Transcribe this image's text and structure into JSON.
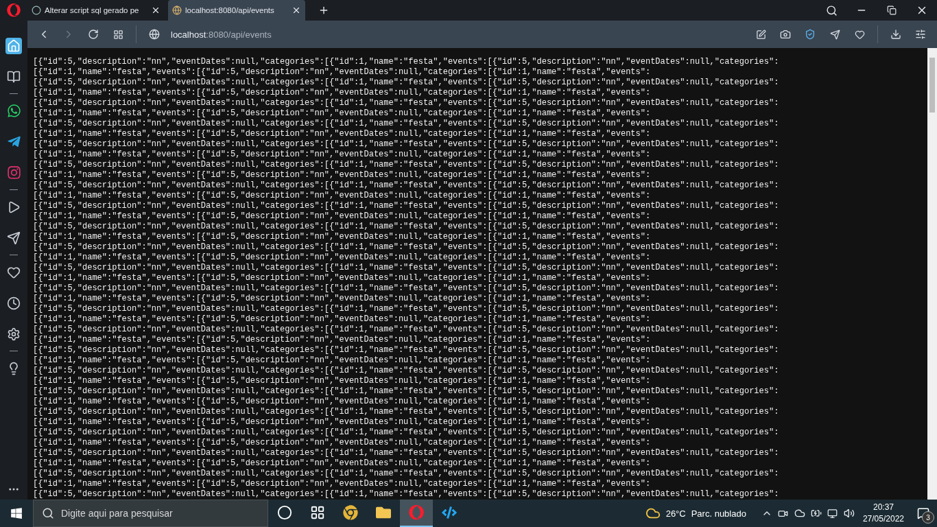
{
  "browser": {
    "tabs": [
      {
        "title": "Alterar script sql gerado pe",
        "selected": false
      },
      {
        "title": "localhost:8080/api/events",
        "selected": true
      }
    ],
    "address": {
      "host": "localhost",
      "path": ":8080/api/events"
    }
  },
  "sidebar": {
    "items": [
      {
        "kind": "home",
        "selected": true
      },
      {
        "kind": "book",
        "selected": false
      },
      {
        "kind": "divider"
      },
      {
        "kind": "chat",
        "selected": false
      },
      {
        "kind": "plane",
        "selected": false
      },
      {
        "kind": "camera",
        "selected": false
      },
      {
        "kind": "divider"
      },
      {
        "kind": "play",
        "selected": false
      },
      {
        "kind": "send",
        "selected": false
      },
      {
        "kind": "divider"
      },
      {
        "kind": "heart",
        "selected": false
      },
      {
        "kind": "clock",
        "selected": false
      },
      {
        "kind": "gear",
        "selected": false
      },
      {
        "kind": "divider"
      },
      {
        "kind": "bulb",
        "selected": false
      }
    ]
  },
  "response": {
    "lines": [
      "[{\"id\":5,\"description\":\"nn\",\"eventDates\":null,\"categories\":[{\"id\":1,\"name\":\"festa\",\"events\":[{\"id\":5,\"description\":\"nn\",\"eventDates\":null,\"categories\":",
      "[{\"id\":1,\"name\":\"festa\",\"events\":[{\"id\":5,\"description\":\"nn\",\"eventDates\":null,\"categories\":[{\"id\":1,\"name\":\"festa\",\"events\":",
      "[{\"id\":5,\"description\":\"nn\",\"eventDates\":null,\"categories\":[{\"id\":1,\"name\":\"festa\",\"events\":[{\"id\":5,\"description\":\"nn\",\"eventDates\":null,\"categories\":",
      "[{\"id\":1,\"name\":\"festa\",\"events\":[{\"id\":5,\"description\":\"nn\",\"eventDates\":null,\"categories\":[{\"id\":1,\"name\":\"festa\",\"events\":",
      "[{\"id\":5,\"description\":\"nn\",\"eventDates\":null,\"categories\":[{\"id\":1,\"name\":\"festa\",\"events\":[{\"id\":5,\"description\":\"nn\",\"eventDates\":null,\"categories\":",
      "[{\"id\":1,\"name\":\"festa\",\"events\":[{\"id\":5,\"description\":\"nn\",\"eventDates\":null,\"categories\":[{\"id\":1,\"name\":\"festa\",\"events\":",
      "[{\"id\":5,\"description\":\"nn\",\"eventDates\":null,\"categories\":[{\"id\":1,\"name\":\"festa\",\"events\":[{\"id\":5,\"description\":\"nn\",\"eventDates\":null,\"categories\":",
      "[{\"id\":1,\"name\":\"festa\",\"events\":[{\"id\":5,\"description\":\"nn\",\"eventDates\":null,\"categories\":[{\"id\":1,\"name\":\"festa\",\"events\":",
      "[{\"id\":5,\"description\":\"nn\",\"eventDates\":null,\"categories\":[{\"id\":1,\"name\":\"festa\",\"events\":[{\"id\":5,\"description\":\"nn\",\"eventDates\":null,\"categories\":",
      "[{\"id\":1,\"name\":\"festa\",\"events\":[{\"id\":5,\"description\":\"nn\",\"eventDates\":null,\"categories\":[{\"id\":1,\"name\":\"festa\",\"events\":",
      "[{\"id\":5,\"description\":\"nn\",\"eventDates\":null,\"categories\":[{\"id\":1,\"name\":\"festa\",\"events\":[{\"id\":5,\"description\":\"nn\",\"eventDates\":null,\"categories\":",
      "[{\"id\":1,\"name\":\"festa\",\"events\":[{\"id\":5,\"description\":\"nn\",\"eventDates\":null,\"categories\":[{\"id\":1,\"name\":\"festa\",\"events\":",
      "[{\"id\":5,\"description\":\"nn\",\"eventDates\":null,\"categories\":[{\"id\":1,\"name\":\"festa\",\"events\":[{\"id\":5,\"description\":\"nn\",\"eventDates\":null,\"categories\":",
      "[{\"id\":1,\"name\":\"festa\",\"events\":[{\"id\":5,\"description\":\"nn\",\"eventDates\":null,\"categories\":[{\"id\":1,\"name\":\"festa\",\"events\":",
      "[{\"id\":5,\"description\":\"nn\",\"eventDates\":null,\"categories\":[{\"id\":1,\"name\":\"festa\",\"events\":[{\"id\":5,\"description\":\"nn\",\"eventDates\":null,\"categories\":",
      "[{\"id\":1,\"name\":\"festa\",\"events\":[{\"id\":5,\"description\":\"nn\",\"eventDates\":null,\"categories\":[{\"id\":1,\"name\":\"festa\",\"events\":",
      "[{\"id\":5,\"description\":\"nn\",\"eventDates\":null,\"categories\":[{\"id\":1,\"name\":\"festa\",\"events\":[{\"id\":5,\"description\":\"nn\",\"eventDates\":null,\"categories\":",
      "[{\"id\":1,\"name\":\"festa\",\"events\":[{\"id\":5,\"description\":\"nn\",\"eventDates\":null,\"categories\":[{\"id\":1,\"name\":\"festa\",\"events\":",
      "[{\"id\":5,\"description\":\"nn\",\"eventDates\":null,\"categories\":[{\"id\":1,\"name\":\"festa\",\"events\":[{\"id\":5,\"description\":\"nn\",\"eventDates\":null,\"categories\":",
      "[{\"id\":1,\"name\":\"festa\",\"events\":[{\"id\":5,\"description\":\"nn\",\"eventDates\":null,\"categories\":[{\"id\":1,\"name\":\"festa\",\"events\":",
      "[{\"id\":5,\"description\":\"nn\",\"eventDates\":null,\"categories\":[{\"id\":1,\"name\":\"festa\",\"events\":[{\"id\":5,\"description\":\"nn\",\"eventDates\":null,\"categories\":",
      "[{\"id\":1,\"name\":\"festa\",\"events\":[{\"id\":5,\"description\":\"nn\",\"eventDates\":null,\"categories\":[{\"id\":1,\"name\":\"festa\",\"events\":",
      "[{\"id\":5,\"description\":\"nn\",\"eventDates\":null,\"categories\":[{\"id\":1,\"name\":\"festa\",\"events\":[{\"id\":5,\"description\":\"nn\",\"eventDates\":null,\"categories\":",
      "[{\"id\":1,\"name\":\"festa\",\"events\":[{\"id\":5,\"description\":\"nn\",\"eventDates\":null,\"categories\":[{\"id\":1,\"name\":\"festa\",\"events\":",
      "[{\"id\":5,\"description\":\"nn\",\"eventDates\":null,\"categories\":[{\"id\":1,\"name\":\"festa\",\"events\":[{\"id\":5,\"description\":\"nn\",\"eventDates\":null,\"categories\":",
      "[{\"id\":1,\"name\":\"festa\",\"events\":[{\"id\":5,\"description\":\"nn\",\"eventDates\":null,\"categories\":[{\"id\":1,\"name\":\"festa\",\"events\":",
      "[{\"id\":5,\"description\":\"nn\",\"eventDates\":null,\"categories\":[{\"id\":1,\"name\":\"festa\",\"events\":[{\"id\":5,\"description\":\"nn\",\"eventDates\":null,\"categories\":",
      "[{\"id\":1,\"name\":\"festa\",\"events\":[{\"id\":5,\"description\":\"nn\",\"eventDates\":null,\"categories\":[{\"id\":1,\"name\":\"festa\",\"events\":",
      "[{\"id\":5,\"description\":\"nn\",\"eventDates\":null,\"categories\":[{\"id\":1,\"name\":\"festa\",\"events\":[{\"id\":5,\"description\":\"nn\",\"eventDates\":null,\"categories\":",
      "[{\"id\":1,\"name\":\"festa\",\"events\":[{\"id\":5,\"description\":\"nn\",\"eventDates\":null,\"categories\":[{\"id\":1,\"name\":\"festa\",\"events\":",
      "[{\"id\":5,\"description\":\"nn\",\"eventDates\":null,\"categories\":[{\"id\":1,\"name\":\"festa\",\"events\":[{\"id\":5,\"description\":\"nn\",\"eventDates\":null,\"categories\":",
      "[{\"id\":1,\"name\":\"festa\",\"events\":[{\"id\":5,\"description\":\"nn\",\"eventDates\":null,\"categories\":[{\"id\":1,\"name\":\"festa\",\"events\":",
      "[{\"id\":5,\"description\":\"nn\",\"eventDates\":null,\"categories\":[{\"id\":1,\"name\":\"festa\",\"events\":[{\"id\":5,\"description\":\"nn\",\"eventDates\":null,\"categories\":",
      "[{\"id\":1,\"name\":\"festa\",\"events\":[{\"id\":5,\"description\":\"nn\",\"eventDates\":null,\"categories\":[{\"id\":1,\"name\":\"festa\",\"events\":",
      "[{\"id\":5,\"description\":\"nn\",\"eventDates\":null,\"categories\":[{\"id\":1,\"name\":\"festa\",\"events\":[{\"id\":5,\"description\":\"nn\",\"eventDates\":null,\"categories\":",
      "[{\"id\":1,\"name\":\"festa\",\"events\":[{\"id\":5,\"description\":\"nn\",\"eventDates\":null,\"categories\":[{\"id\":1,\"name\":\"festa\",\"events\":",
      "[{\"id\":5,\"description\":\"nn\",\"eventDates\":null,\"categories\":[{\"id\":1,\"name\":\"festa\",\"events\":[{\"id\":5,\"description\":\"nn\",\"eventDates\":null,\"categories\":",
      "[{\"id\":1,\"name\":\"festa\",\"events\":[{\"id\":5,\"description\":\"nn\",\"eventDates\":null,\"categories\":[{\"id\":1,\"name\":\"festa\",\"events\":",
      "[{\"id\":5,\"description\":\"nn\",\"eventDates\":null,\"categories\":[{\"id\":1,\"name\":\"festa\",\"events\":[{\"id\":5,\"description\":\"nn\",\"eventDates\":null,\"categories\":",
      "[{\"id\":1,\"name\":\"festa\",\"events\":[{\"id\":5,\"description\":\"nn\",\"eventDates\":null,\"categories\":[{\"id\":1,\"name\":\"festa\",\"events\":",
      "[{\"id\":5,\"description\":\"nn\",\"eventDates\":null,\"categories\":[{\"id\":1,\"name\":\"festa\",\"events\":[{\"id\":5,\"description\":\"nn\",\"eventDates\":null,\"categories\":",
      "[{\"id\":1,\"name\":\"festa\",\"events\":[{\"id\":5,\"description\":\"nn\",\"eventDates\":null,\"categories\":[{\"id\":1,\"name\":\"festa\",\"events\":",
      "[{\"id\":5,\"description\":\"nn\",\"eventDates\":null,\"categories\":[{\"id\":1,\"name\":\"festa\",\"events\":[{\"id\":5,\"description\":\"nn\",\"eventDates\":null,\"categories\":"
    ]
  },
  "taskbar": {
    "search": {
      "placeholder": "Digite aqui para pesquisar"
    },
    "apps": [
      {
        "kind": "circle",
        "selected": false
      },
      {
        "kind": "taskview",
        "selected": false
      },
      {
        "kind": "chrome",
        "selected": false
      },
      {
        "kind": "folder",
        "selected": false
      },
      {
        "kind": "opera",
        "selected": true
      },
      {
        "kind": "code",
        "selected": false
      }
    ],
    "weather": {
      "temperature": "26°C",
      "condition": "Parc. nublado"
    },
    "time": "20:37",
    "date": "27/05/2022",
    "notifications": "3"
  }
}
